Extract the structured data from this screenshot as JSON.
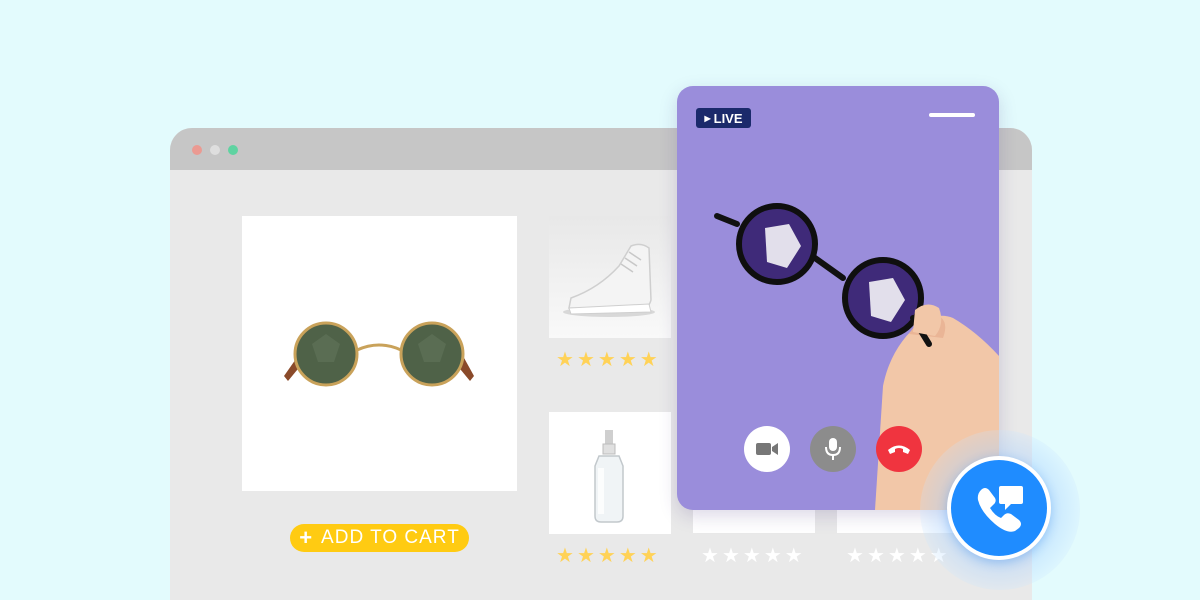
{
  "browser": {
    "window_dots": [
      "close",
      "minimize",
      "maximize"
    ]
  },
  "product": {
    "main_image": "round-sunglasses",
    "add_to_cart": {
      "icon": "+",
      "label": "ADD TO CART"
    }
  },
  "related_products": [
    {
      "image": "white-sneaker",
      "rating": 5,
      "stars": "★★★★★"
    },
    {
      "image": "spray-bottle",
      "rating": 5,
      "stars": "★★★★★"
    },
    {
      "image": "blank",
      "rating": 5,
      "stars": "★★★★★"
    },
    {
      "image": "blank",
      "rating": 5,
      "stars": "★★★★★"
    }
  ],
  "video_call": {
    "live_label": "LIVE",
    "live_icon": "▶",
    "controls": [
      "camera-icon",
      "microphone-icon",
      "end-call-icon"
    ]
  },
  "call_button": {
    "icon": "phone-chat-icon"
  },
  "colors": {
    "background": "#e3fbfd",
    "video_bg": "#9a8ddb",
    "accent_yellow": "#ffcb12",
    "call_blue": "#1f8cff",
    "end_red": "#f0343f",
    "live_badge": "#1b2a6b"
  }
}
